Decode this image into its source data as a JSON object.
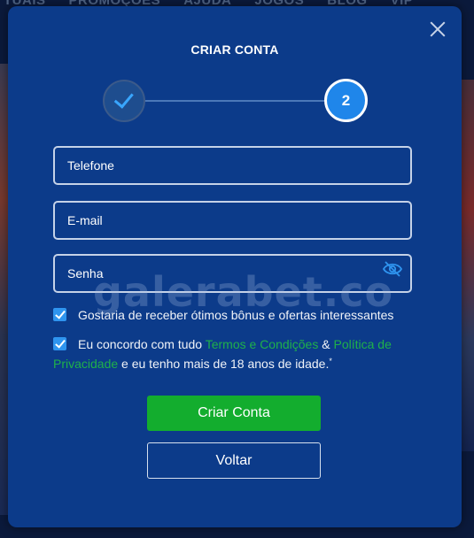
{
  "background": {
    "nav": [
      "TUAIS",
      "PROMOÇÕES",
      "AJUDA",
      "JOGOS",
      "BLOG",
      "VIP"
    ]
  },
  "modal": {
    "title": "CRIAR CONTA",
    "stepper": {
      "current_step": "2",
      "completed_step_icon": "check-icon"
    },
    "fields": {
      "phone_placeholder": "Telefone",
      "email_placeholder": "E-mail",
      "password_placeholder": "Senha"
    },
    "consents": {
      "bonus_text": "Gostaria de receber ótimos bônus e ofertas interessantes",
      "terms_prefix": "Eu concordo com tudo",
      "terms_link": "Termos e Condições",
      "terms_amp": "&",
      "privacy_link": "Política de Privacidade",
      "terms_suffix": "e eu tenho mais de 18 anos de idade.",
      "required_mark": "*"
    },
    "buttons": {
      "create": "Criar Conta",
      "back": "Voltar"
    },
    "watermark": "galerabet.co",
    "colors": {
      "modal_bg": "#0c3b8a",
      "primary_button": "#13ad2e",
      "link": "#1fb14a",
      "accent": "#1f86ea"
    }
  }
}
